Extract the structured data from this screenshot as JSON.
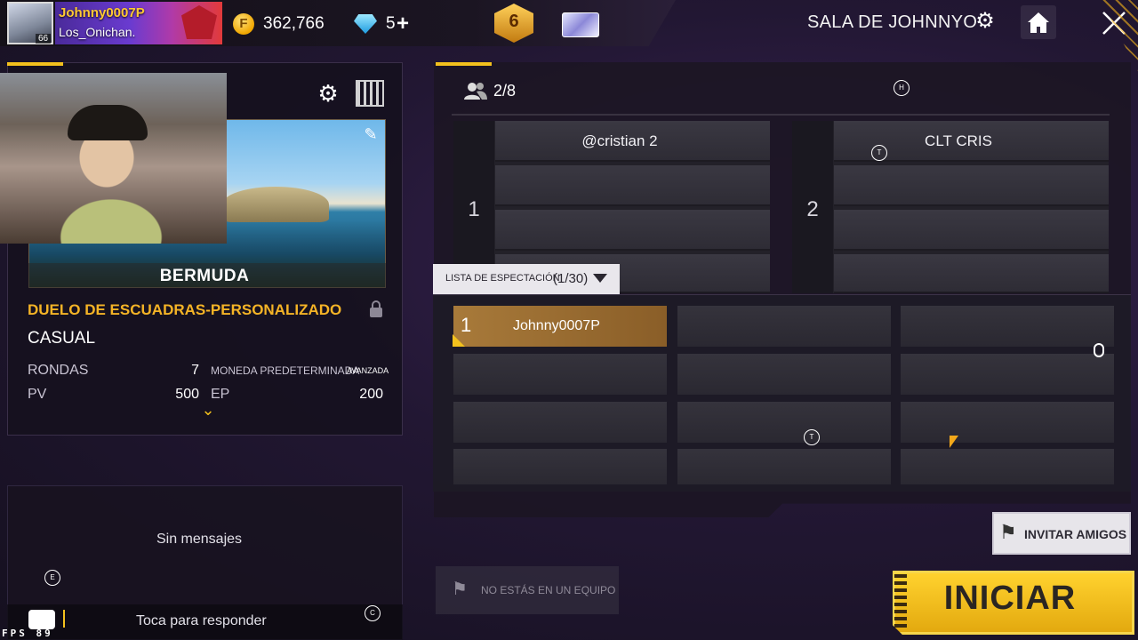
{
  "player": {
    "name": "Johnny0007P",
    "guild": "Los_Onichan.",
    "level": "66"
  },
  "currency": {
    "coins": "362,766",
    "diamonds": "5",
    "diamond_plus": "+"
  },
  "rank": {
    "level": "6"
  },
  "room": {
    "title": "SALA DE JOHNNYO"
  },
  "map": {
    "name": "BERMUDA"
  },
  "mode": {
    "title": "DUELO DE ESCUADRAS-PERSONALIZADO",
    "type": "CASUAL",
    "rounds_label": "RONDAS",
    "rounds_value": "7",
    "currency_label": "MONEDA PREDETERMINADA",
    "currency_value": "AVANZADA",
    "hp_label": "PV",
    "hp_value": "500",
    "ep_label": "EP",
    "ep_value": "200"
  },
  "chat": {
    "empty": "Sin mensajes",
    "reply": "Toca para responder"
  },
  "fps": "FPS 89",
  "lobby": {
    "players": "2/8",
    "teams": [
      {
        "number": "1",
        "slots": [
          "@cristian   2",
          "",
          "",
          ""
        ]
      },
      {
        "number": "2",
        "slots": [
          "CLT   CRIS",
          "",
          "",
          ""
        ]
      }
    ]
  },
  "spectators": {
    "label": "LISTA DE ESPECTACIÓN",
    "count": "(1/30)",
    "slots": [
      {
        "num": "1",
        "name": "Johnny0007P"
      }
    ]
  },
  "not_in_team": "NO ESTÁS EN UN EQUIPO",
  "invite": "INVITAR AMIGOS",
  "start": "INICIAR",
  "markers": {
    "h": "H",
    "t1": "T",
    "t2": "T",
    "e": "E",
    "c": "C"
  },
  "colors": {
    "accent": "#f3c11d",
    "mode_title": "#f5b426",
    "start_button": "#ffd22e"
  }
}
